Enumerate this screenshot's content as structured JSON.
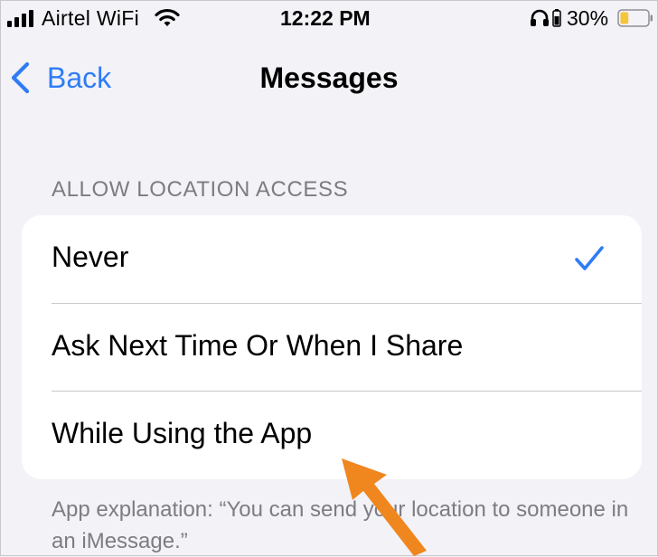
{
  "status_bar": {
    "carrier": "Airtel WiFi",
    "time": "12:22 PM",
    "battery_percent": "30%",
    "battery_level": 0.3,
    "battery_color": "#f5c53b"
  },
  "nav": {
    "back_label": "Back",
    "title": "Messages"
  },
  "section": {
    "header": "ALLOW LOCATION ACCESS",
    "options": [
      {
        "label": "Never",
        "selected": true
      },
      {
        "label": "Ask Next Time Or When I Share",
        "selected": false
      },
      {
        "label": "While Using the App",
        "selected": false
      }
    ],
    "footer": "App explanation: “You can send your location to someone in an iMessage.”"
  },
  "colors": {
    "accent": "#2f7cf6",
    "annotation_arrow": "#f0861e"
  },
  "icons": [
    "cellular-signal-icon",
    "wifi-icon",
    "headphones-icon",
    "battery-icon",
    "chevron-left-icon",
    "checkmark-icon",
    "annotation-arrow"
  ]
}
